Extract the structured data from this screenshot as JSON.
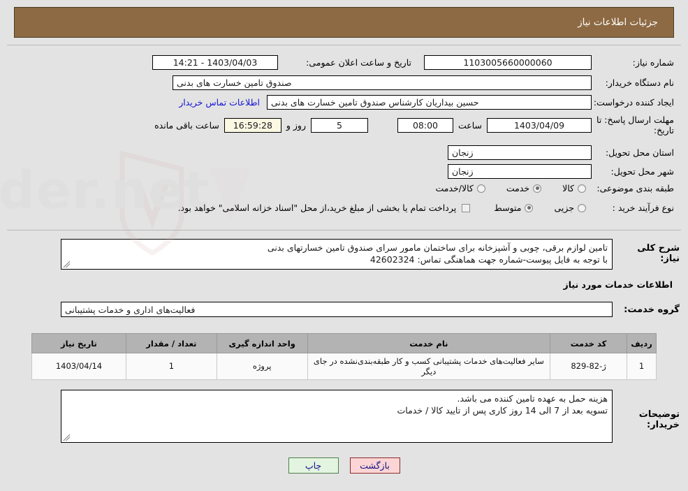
{
  "header": {
    "title": "جزئیات اطلاعات نیاز"
  },
  "form": {
    "need_number_label": "شماره نیاز:",
    "need_number_value": "1103005660000060",
    "announce_datetime_label": "تاریخ و ساعت اعلان عمومی:",
    "announce_datetime_value": "1403/04/03 - 14:21",
    "buyer_org_label": "نام دستگاه خریدار:",
    "buyer_org_value": "صندوق تامین خسارت های بدنی",
    "creator_label": "ایجاد کننده درخواست:",
    "creator_value": "حسین بیداریان کارشناس صندوق تامین خسارت های بدنی",
    "contact_link": "اطلاعات تماس خریدار",
    "deadline_label": "مهلت ارسال پاسخ: تا تاریخ:",
    "deadline_date": "1403/04/09",
    "hour_label": "ساعت",
    "deadline_hour": "08:00",
    "days_value": "5",
    "days_label": "روز و",
    "timer_value": "16:59:28",
    "remaining_label": "ساعت باقی مانده",
    "province_label": "استان محل تحویل:",
    "province_value": "زنجان",
    "city_label": "شهر محل تحویل:",
    "city_value": "زنجان",
    "category_label": "طبقه بندی موضوعی:",
    "category_options": [
      {
        "label": "کالا",
        "selected": false
      },
      {
        "label": "خدمت",
        "selected": true
      },
      {
        "label": "کالا/خدمت",
        "selected": false
      }
    ],
    "process_label": "نوع فرآیند خرید :",
    "process_options": [
      {
        "label": "جزیی",
        "selected": false
      },
      {
        "label": "متوسط",
        "selected": true
      }
    ],
    "treasury_checkbox_checked": false,
    "treasury_note": "پرداخت تمام یا بخشی از مبلغ خرید،از محل \"اسناد خزانه اسلامی\" خواهد بود."
  },
  "description": {
    "label": "شرح کلی نیاز:",
    "line1": "تامین لوازم برقی، چوبی و آشپزخانه برای ساختمان مامور سرای صندوق تامین خسارتهای بدنی",
    "line2": "با توجه به فایل پیوست-شماره جهت هماهنگی تماس: 42602324"
  },
  "services_section": {
    "title": "اطلاعات خدمات مورد نیاز",
    "group_label": "گروه خدمت:",
    "group_value": "فعالیت‌های اداری و خدمات پشتیبانی"
  },
  "table": {
    "headers": [
      "ردیف",
      "کد خدمت",
      "نام خدمت",
      "واحد اندازه گیری",
      "تعداد / مقدار",
      "تاریخ نیاز"
    ],
    "rows": [
      {
        "row_no": "1",
        "service_code": "ژ-82-829",
        "service_name": "سایر فعالیت‌های خدمات پشتیبانی کسب و کار طبقه‌بندی‌نشده در جای دیگر",
        "unit": "پروژه",
        "quantity": "1",
        "need_date": "1403/04/14"
      }
    ]
  },
  "buyer_notes": {
    "label": "توضیحات خریدار:",
    "line1": "هزینه حمل به عهده تامین کننده می باشد.",
    "line2": "تسویه بعد از 7 الی 14 روز کاری پس از تایید کالا / خدمات"
  },
  "footer": {
    "back_label": "بازگشت",
    "print_label": "چاپ"
  },
  "watermark": {
    "text": "AriaTender.net"
  },
  "colors": {
    "header_bg": "#8d6a43",
    "page_bg": "#e3e3e3",
    "link": "#1414d2",
    "table_header_bg": "#b3b3b3",
    "back_btn_bg": "#fbd5d5",
    "print_btn_bg": "#e3f5e0",
    "timer_bg": "#fbf8e3"
  }
}
